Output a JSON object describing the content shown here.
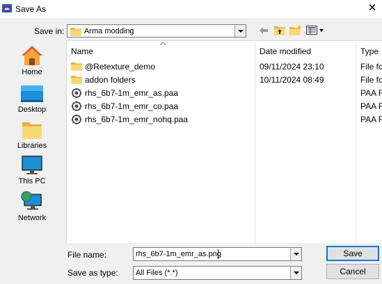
{
  "window": {
    "title": "Save As",
    "close_glyph": "✕"
  },
  "save_in": {
    "label": "Save in:",
    "value": "Arma modding"
  },
  "places": [
    {
      "label": "Home",
      "icon": "home-icon"
    },
    {
      "label": "Desktop",
      "icon": "desktop-icon"
    },
    {
      "label": "Libraries",
      "icon": "libraries-icon"
    },
    {
      "label": "This PC",
      "icon": "this-pc-icon"
    },
    {
      "label": "Network",
      "icon": "network-icon"
    }
  ],
  "columns": {
    "name": "Name",
    "date": "Date modified",
    "type": "Type"
  },
  "files": [
    {
      "name": "@Retexture_demo",
      "date": "09/11/2024 23:10",
      "type": "File fo",
      "icon": "folder-icon"
    },
    {
      "name": "addon folders",
      "date": "10/11/2024 08:49",
      "type": "File fo",
      "icon": "folder-icon"
    },
    {
      "name": "rhs_6b7-1m_emr_as.paa",
      "date": "",
      "type": "PAA F",
      "icon": "paa-file-icon"
    },
    {
      "name": "rhs_6b7-1m_emr_co.paa",
      "date": "",
      "type": "PAA F",
      "icon": "paa-file-icon"
    },
    {
      "name": "rhs_6b7-1m_emr_nohq.paa",
      "date": "",
      "type": "PAA F",
      "icon": "paa-file-icon"
    }
  ],
  "file_name": {
    "label": "File name:",
    "value": "rhs_6b7-1m_emr_as.png"
  },
  "save_as_type": {
    "label": "Save as type:",
    "value": "All Files (*.*)"
  },
  "buttons": {
    "save": "Save",
    "cancel": "Cancel"
  },
  "colors": {
    "folder": "#f8d775",
    "folder_dark": "#e3b341",
    "accent": "#0078d7"
  }
}
